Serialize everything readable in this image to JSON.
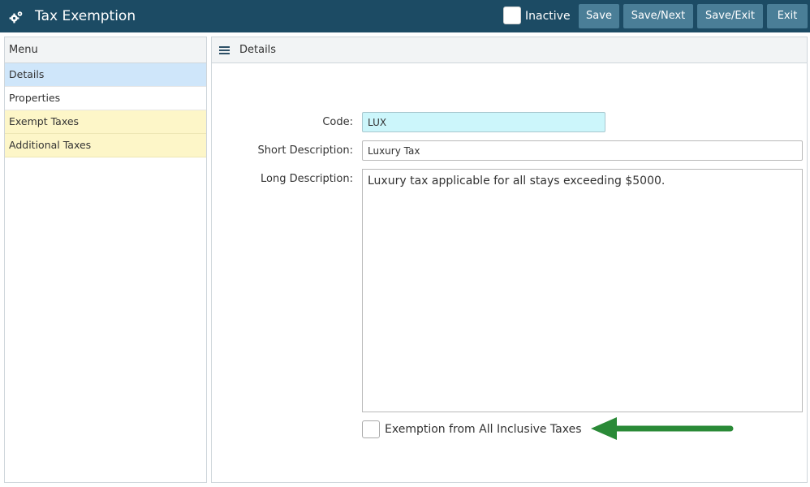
{
  "header": {
    "title": "Tax Exemption",
    "app_icon": "gears-icon",
    "inactive_label": "Inactive",
    "buttons": {
      "save": "Save",
      "save_next": "Save/Next",
      "save_exit": "Save/Exit",
      "exit": "Exit"
    }
  },
  "menu": {
    "title": "Menu",
    "items": [
      {
        "label": "Details"
      },
      {
        "label": "Properties"
      },
      {
        "label": "Exempt Taxes"
      },
      {
        "label": "Additional Taxes"
      }
    ]
  },
  "details": {
    "title": "Details",
    "code_label": "Code:",
    "code_value": "LUX",
    "short_label": "Short Description:",
    "short_value": "Luxury Tax",
    "long_label": "Long Description:",
    "long_value": "Luxury tax applicable for all stays exceeding $5000.",
    "exempt_label": "Exemption from All Inclusive Taxes"
  },
  "colors": {
    "header_bg": "#1c4b64",
    "button_bg": "#4a7e97",
    "menu_active": "#cfe6fa",
    "menu_highlight": "#fdf6c8",
    "code_field_bg": "#ccf6fb",
    "arrow": "#2a8a37"
  }
}
